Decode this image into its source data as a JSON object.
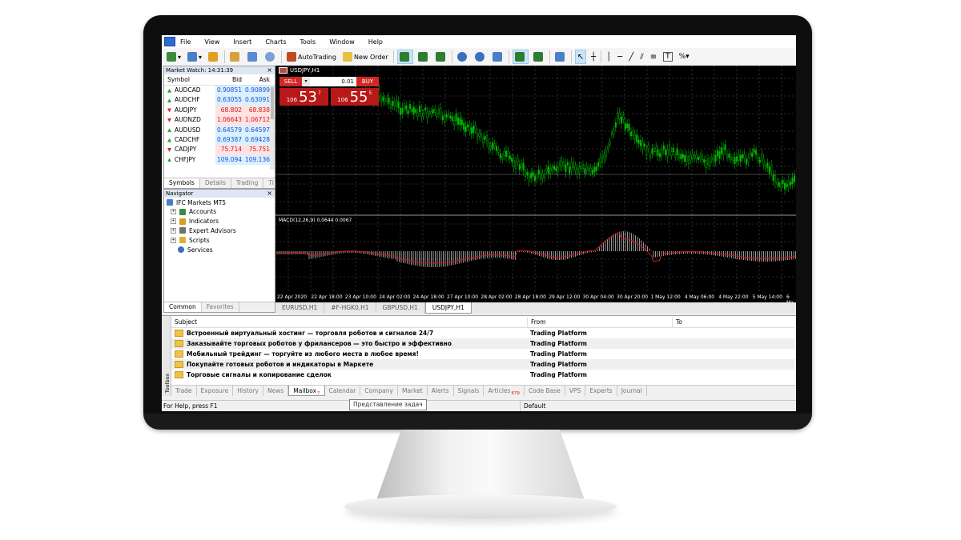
{
  "menu": [
    "File",
    "View",
    "Insert",
    "Charts",
    "Tools",
    "Window",
    "Help"
  ],
  "toolbar": {
    "autotrading_label": "AutoTrading",
    "neworder_label": "New Order"
  },
  "market_watch": {
    "title": "Market Watch: 14:31:39",
    "col_symbol": "Symbol",
    "col_bid": "Bid",
    "col_ask": "Ask",
    "rows": [
      {
        "symbol": "AUDCAD",
        "bid": "0.90851",
        "ask": "0.90899",
        "dir": "up"
      },
      {
        "symbol": "AUDCHF",
        "bid": "0.63055",
        "ask": "0.63091",
        "dir": "up"
      },
      {
        "symbol": "AUDJPY",
        "bid": "68.802",
        "ask": "68.838",
        "dir": "dn"
      },
      {
        "symbol": "AUDNZD",
        "bid": "1.06643",
        "ask": "1.06712",
        "dir": "dn"
      },
      {
        "symbol": "AUDUSD",
        "bid": "0.64579",
        "ask": "0.64597",
        "dir": "up"
      },
      {
        "symbol": "CADCHF",
        "bid": "0.69387",
        "ask": "0.69428",
        "dir": "up"
      },
      {
        "symbol": "CADJPY",
        "bid": "75.714",
        "ask": "75.751",
        "dir": "dn"
      },
      {
        "symbol": "CHFJPY",
        "bid": "109.094",
        "ask": "109.136",
        "dir": "up"
      }
    ],
    "tabs": [
      "Symbols",
      "Details",
      "Trading",
      "Ti"
    ]
  },
  "navigator": {
    "title": "Navigator",
    "root": "IFC Markets MT5",
    "items": [
      "Accounts",
      "Indicators",
      "Expert Advisors",
      "Scripts",
      "Services"
    ],
    "tabs": [
      "Common",
      "Favorites"
    ]
  },
  "chart": {
    "symbol_title": "USDJPY,H1",
    "sell_label": "SELL",
    "buy_label": "BUY",
    "lot": "0.01",
    "sell_price": {
      "small": "106",
      "big": "53",
      "sup": "7"
    },
    "buy_price": {
      "small": "106",
      "big": "55",
      "sup": "5"
    },
    "macd_label": "MACD(12,26,9) 0.0644 0.0067",
    "x_labels": [
      "22 Apr 2020",
      "22 Apr 18:00",
      "23 Apr 10:00",
      "24 Apr 02:00",
      "24 Apr 18:00",
      "27 Apr 10:00",
      "28 Apr 02:00",
      "28 Apr 18:00",
      "29 Apr 12:00",
      "30 Apr 04:00",
      "30 Apr 20:00",
      "1 May 12:00",
      "4 May 06:00",
      "4 May 22:00",
      "5 May 14:00",
      "6 Ma"
    ],
    "tabs": [
      "EURUSD,H1",
      "#F-HGK0,H1",
      "GBPUSD,H1",
      "USDJPY,H1"
    ],
    "colors": {
      "bull": "#00b400",
      "bear": "#00b400",
      "signal": "#d01818"
    }
  },
  "mailbox": {
    "col_subject": "Subject",
    "col_from": "From",
    "col_to": "To",
    "rows": [
      {
        "subject": "Встроенный виртуальный хостинг — торговля роботов и сигналов 24/7",
        "from": "Trading Platform"
      },
      {
        "subject": "Заказывайте торговых роботов у фрилансеров — это быстро и эффективно",
        "from": "Trading Platform"
      },
      {
        "subject": "Мобильный трейдинг — торгуйте из любого места в любое время!",
        "from": "Trading Platform"
      },
      {
        "subject": "Покупайте готовых роботов и индикаторы в Маркете",
        "from": "Trading Platform"
      },
      {
        "subject": "Торговые сигналы и копирование сделок",
        "from": "Trading Platform"
      }
    ]
  },
  "toolbox": {
    "side_label": "Toolbox",
    "tabs": [
      {
        "label": "Trade"
      },
      {
        "label": "Exposure"
      },
      {
        "label": "History"
      },
      {
        "label": "News"
      },
      {
        "label": "Mailbox",
        "badge": "7"
      },
      {
        "label": "Calendar"
      },
      {
        "label": "Company"
      },
      {
        "label": "Market"
      },
      {
        "label": "Alerts"
      },
      {
        "label": "Signals"
      },
      {
        "label": "Articles",
        "badge": "679"
      },
      {
        "label": "Code Base"
      },
      {
        "label": "VPS"
      },
      {
        "label": "Experts"
      },
      {
        "label": "Journal"
      }
    ]
  },
  "status": {
    "help": "For Help, press F1",
    "profile": "Default",
    "tooltip": "Представление задач"
  }
}
